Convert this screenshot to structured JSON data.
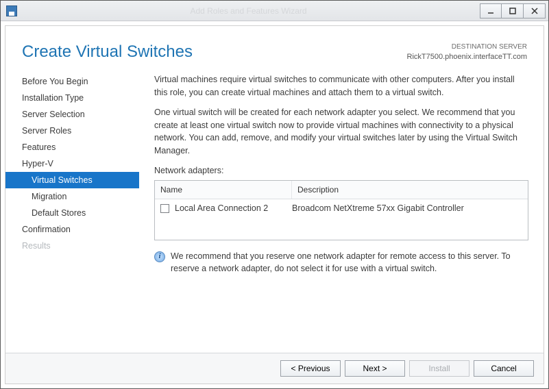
{
  "window": {
    "title": "Add Roles and Features Wizard"
  },
  "header": {
    "page_title": "Create Virtual Switches",
    "destination_label": "DESTINATION SERVER",
    "destination_value": "RickT7500.phoenix.interfaceTT.com"
  },
  "sidebar": {
    "items": [
      {
        "label": "Before You Begin"
      },
      {
        "label": "Installation Type"
      },
      {
        "label": "Server Selection"
      },
      {
        "label": "Server Roles"
      },
      {
        "label": "Features"
      },
      {
        "label": "Hyper-V"
      },
      {
        "label": "Virtual Switches"
      },
      {
        "label": "Migration"
      },
      {
        "label": "Default Stores"
      },
      {
        "label": "Confirmation"
      },
      {
        "label": "Results"
      }
    ]
  },
  "main": {
    "para1": "Virtual machines require virtual switches to communicate with other computers. After you install this role, you can create virtual machines and attach them to a virtual switch.",
    "para2": "One virtual switch will be created for each network adapter you select. We recommend that you create at least one virtual switch now to provide virtual machines with connectivity to a physical network. You can add, remove, and modify your virtual switches later by using the Virtual Switch Manager.",
    "table_label": "Network adapters:",
    "columns": {
      "name": "Name",
      "desc": "Description"
    },
    "adapters": [
      {
        "name": "Local Area Connection 2",
        "desc": "Broadcom NetXtreme 57xx Gigabit Controller",
        "checked": false
      }
    ],
    "note": "We recommend that you reserve one network adapter for remote access to this server. To reserve a network adapter, do not select it for use with a virtual switch."
  },
  "buttons": {
    "previous": "< Previous",
    "next": "Next >",
    "install": "Install",
    "cancel": "Cancel"
  }
}
